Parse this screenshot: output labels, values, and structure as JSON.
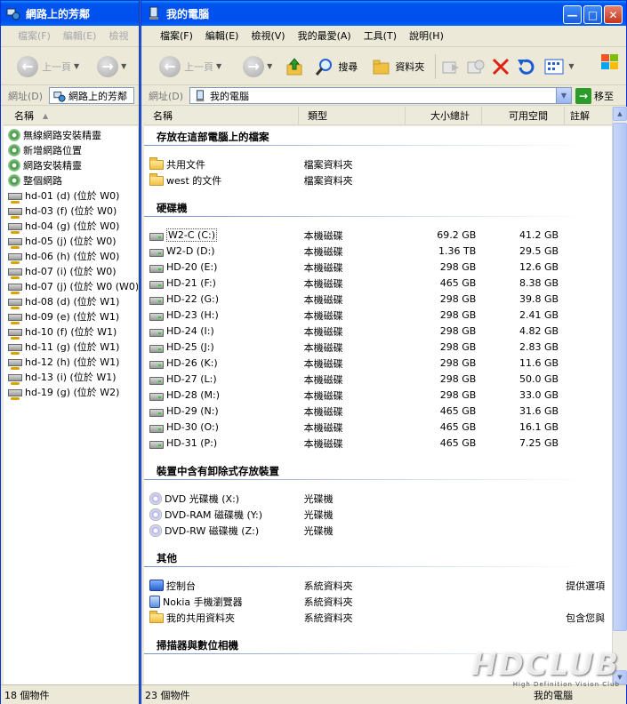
{
  "left": {
    "title": "網路上的芳鄰",
    "menu": [
      "檔案(F)",
      "編輯(E)",
      "檢視"
    ],
    "back_label": "上一頁",
    "address_label": "網址(D)",
    "address_value": "網路上的芳鄰",
    "col_name": "名稱",
    "items": [
      {
        "name": "無線網路安裝精靈",
        "icon": "wizard-icon"
      },
      {
        "name": "新增網路位置",
        "icon": "wizard-icon"
      },
      {
        "name": "網路安裝精靈",
        "icon": "wizard-icon"
      },
      {
        "name": "整個網路",
        "icon": "globe-icon"
      },
      {
        "name": "hd-01 (d) (位於 W0)",
        "icon": "network-drive-icon"
      },
      {
        "name": "hd-03 (f) (位於 W0)",
        "icon": "network-drive-icon"
      },
      {
        "name": "hd-04 (g) (位於 W0)",
        "icon": "network-drive-icon"
      },
      {
        "name": "hd-05 (j) (位於 W0)",
        "icon": "network-drive-icon"
      },
      {
        "name": "hd-06 (h) (位於 W0)",
        "icon": "network-drive-icon"
      },
      {
        "name": "hd-07 (i) (位於 W0)",
        "icon": "network-drive-icon"
      },
      {
        "name": "hd-07 (j) (位於 W0 (W0))",
        "icon": "network-drive-icon"
      },
      {
        "name": "hd-08 (d) (位於 W1)",
        "icon": "network-drive-icon"
      },
      {
        "name": "hd-09 (e) (位於 W1)",
        "icon": "network-drive-icon"
      },
      {
        "name": "hd-10 (f) (位於 W1)",
        "icon": "network-drive-icon"
      },
      {
        "name": "hd-11 (g) (位於 W1)",
        "icon": "network-drive-icon"
      },
      {
        "name": "hd-12 (h) (位於 W1)",
        "icon": "network-drive-icon"
      },
      {
        "name": "hd-13 (i) (位於 W1)",
        "icon": "network-drive-icon"
      },
      {
        "name": "hd-19 (g) (位於 W2)",
        "icon": "network-drive-icon"
      }
    ],
    "status": "18 個物件"
  },
  "right": {
    "title": "我的電腦",
    "menu": [
      "檔案(F)",
      "編輯(E)",
      "檢視(V)",
      "我的最愛(A)",
      "工具(T)",
      "說明(H)"
    ],
    "toolbar": {
      "back": "上一頁",
      "search": "搜尋",
      "folders": "資料夾"
    },
    "address_label": "網址(D)",
    "address_value": "我的電腦",
    "go_label": "移至",
    "columns": {
      "name": "名稱",
      "type": "類型",
      "total": "大小總計",
      "free": "可用空間",
      "comment": "註解"
    },
    "groups": [
      {
        "title": "存放在這部電腦上的檔案",
        "rows": [
          {
            "name": "共用文件",
            "type": "檔案資料夾",
            "icon": "folder-icon"
          },
          {
            "name": "west 的文件",
            "type": "檔案資料夾",
            "icon": "folder-icon"
          }
        ]
      },
      {
        "title": "硬碟機",
        "rows": [
          {
            "name": "W2-C (C:)",
            "type": "本機磁碟",
            "total": "69.2 GB",
            "free": "41.2 GB",
            "icon": "hard-drive-icon"
          },
          {
            "name": "W2-D (D:)",
            "type": "本機磁碟",
            "total": "1.36 TB",
            "free": "29.5 GB",
            "icon": "shared-drive-icon"
          },
          {
            "name": "HD-20 (E:)",
            "type": "本機磁碟",
            "total": "298 GB",
            "free": "12.6 GB",
            "icon": "hard-drive-icon"
          },
          {
            "name": "HD-21 (F:)",
            "type": "本機磁碟",
            "total": "465 GB",
            "free": "8.38 GB",
            "icon": "hard-drive-icon"
          },
          {
            "name": "HD-22 (G:)",
            "type": "本機磁碟",
            "total": "298 GB",
            "free": "39.8 GB",
            "icon": "hard-drive-icon"
          },
          {
            "name": "HD-23 (H:)",
            "type": "本機磁碟",
            "total": "298 GB",
            "free": "2.41 GB",
            "icon": "hard-drive-icon"
          },
          {
            "name": "HD-24 (I:)",
            "type": "本機磁碟",
            "total": "298 GB",
            "free": "4.82 GB",
            "icon": "hard-drive-icon"
          },
          {
            "name": "HD-25 (J:)",
            "type": "本機磁碟",
            "total": "298 GB",
            "free": "2.83 GB",
            "icon": "hard-drive-icon"
          },
          {
            "name": "HD-26 (K:)",
            "type": "本機磁碟",
            "total": "298 GB",
            "free": "11.6 GB",
            "icon": "hard-drive-icon"
          },
          {
            "name": "HD-27 (L:)",
            "type": "本機磁碟",
            "total": "298 GB",
            "free": "50.0 GB",
            "icon": "hard-drive-icon"
          },
          {
            "name": "HD-28 (M:)",
            "type": "本機磁碟",
            "total": "298 GB",
            "free": "33.0 GB",
            "icon": "hard-drive-icon"
          },
          {
            "name": "HD-29 (N:)",
            "type": "本機磁碟",
            "total": "465 GB",
            "free": "31.6 GB",
            "icon": "hard-drive-icon"
          },
          {
            "name": "HD-30 (O:)",
            "type": "本機磁碟",
            "total": "465 GB",
            "free": "16.1 GB",
            "icon": "hard-drive-icon"
          },
          {
            "name": "HD-31 (P:)",
            "type": "本機磁碟",
            "total": "465 GB",
            "free": "7.25 GB",
            "icon": "hard-drive-icon"
          }
        ]
      },
      {
        "title": "裝置中含有卸除式存放裝置",
        "rows": [
          {
            "name": "DVD 光碟機 (X:)",
            "type": "光碟機",
            "icon": "cd-drive-icon"
          },
          {
            "name": "DVD-RAM 磁碟機 (Y:)",
            "type": "光碟機",
            "icon": "cd-drive-icon"
          },
          {
            "name": "DVD-RW 磁碟機 (Z:)",
            "type": "光碟機",
            "icon": "cd-drive-icon"
          }
        ]
      },
      {
        "title": "其他",
        "rows": [
          {
            "name": "控制台",
            "type": "系統資料夾",
            "comment": "提供選項",
            "icon": "control-panel-icon"
          },
          {
            "name": "Nokia 手機瀏覽器",
            "type": "系統資料夾",
            "icon": "phone-browser-icon"
          },
          {
            "name": "我的共用資料夾",
            "type": "系統資料夾",
            "comment": "包含您與",
            "icon": "shared-folder-icon"
          }
        ]
      },
      {
        "title": "掃描器與數位相機",
        "rows": []
      }
    ],
    "status": "23 個物件",
    "status_right": "我的電腦"
  },
  "watermark": {
    "text": "HDCLUB",
    "sub": "High Definition Vision Club"
  }
}
